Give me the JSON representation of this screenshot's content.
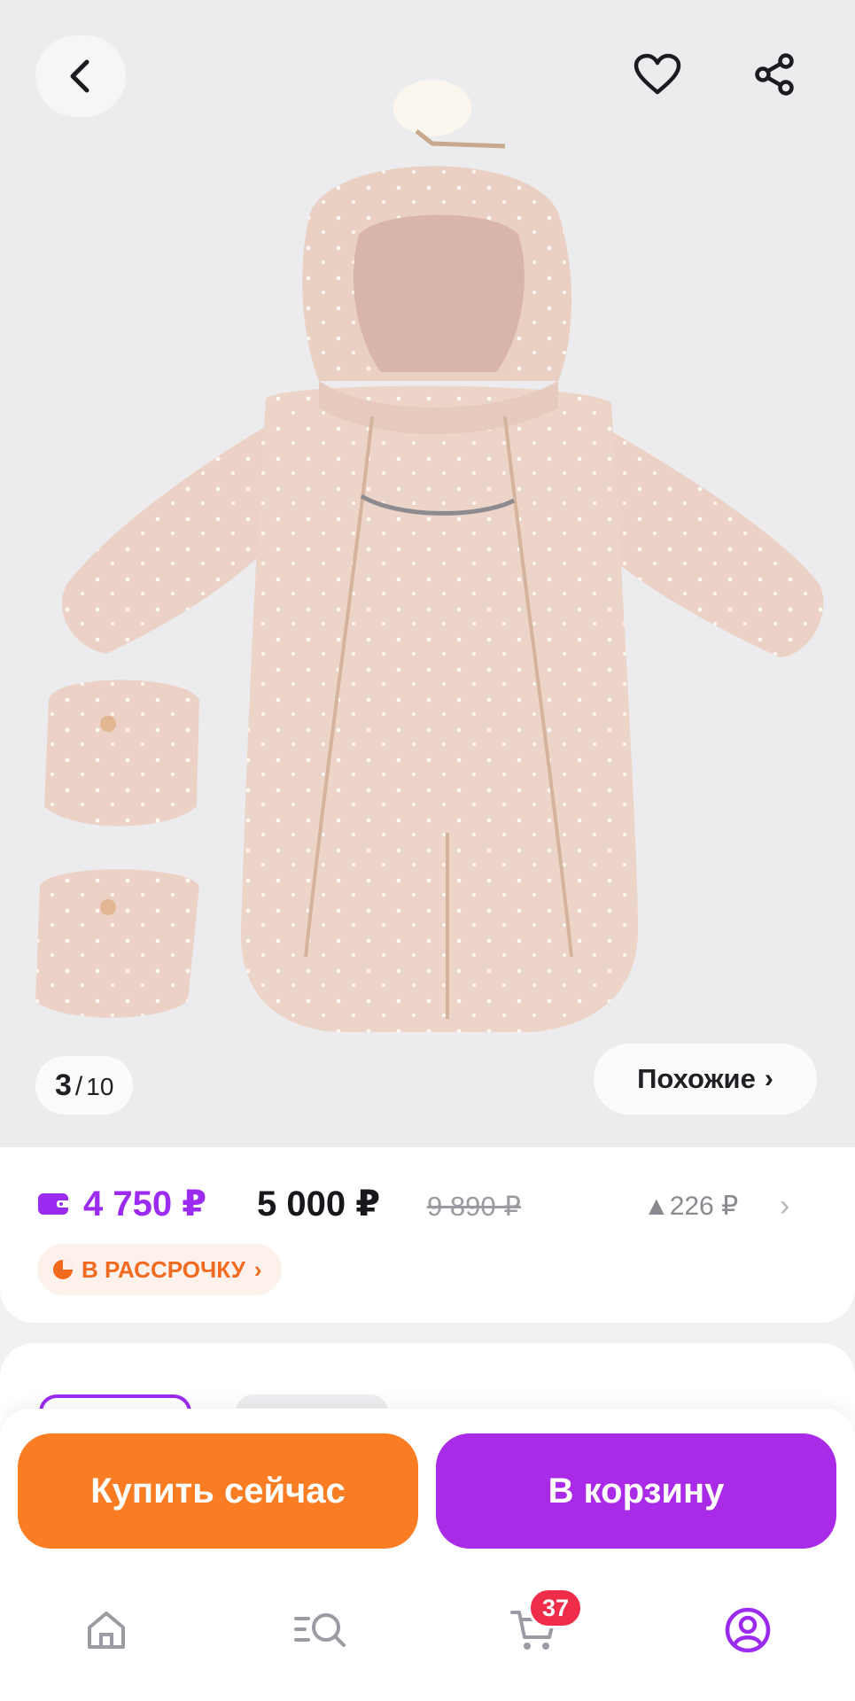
{
  "gallery": {
    "current": "3",
    "separator": "/",
    "total": "10",
    "similar_label": "Похожие",
    "similar_chevron": "›"
  },
  "top_bar": {
    "back_icon": "chevron-left-icon",
    "favorite_icon": "heart-icon",
    "share_icon": "share-icon"
  },
  "price": {
    "wallet_price": "4 750 ₽",
    "price": "5 000 ₽",
    "old_price": "9 890 ₽",
    "delta": "▲226 ₽",
    "delta_chevron": "›",
    "installment_label": "В РАССРОЧКУ",
    "installment_chevron": "›"
  },
  "actions": {
    "buy_now": "Купить сейчас",
    "add_to_cart": "В корзину"
  },
  "bottom_nav": {
    "items": [
      "home-icon",
      "catalog-search-icon",
      "cart-icon",
      "profile-icon"
    ],
    "cart_badge": "37",
    "active": "profile-icon"
  },
  "colors": {
    "wallet_accent": "#9b2bf0",
    "buy_button": "#fb7d23",
    "cart_button": "#a92be8",
    "installment_text": "#f26a1f",
    "badge": "#ef2d4a"
  }
}
